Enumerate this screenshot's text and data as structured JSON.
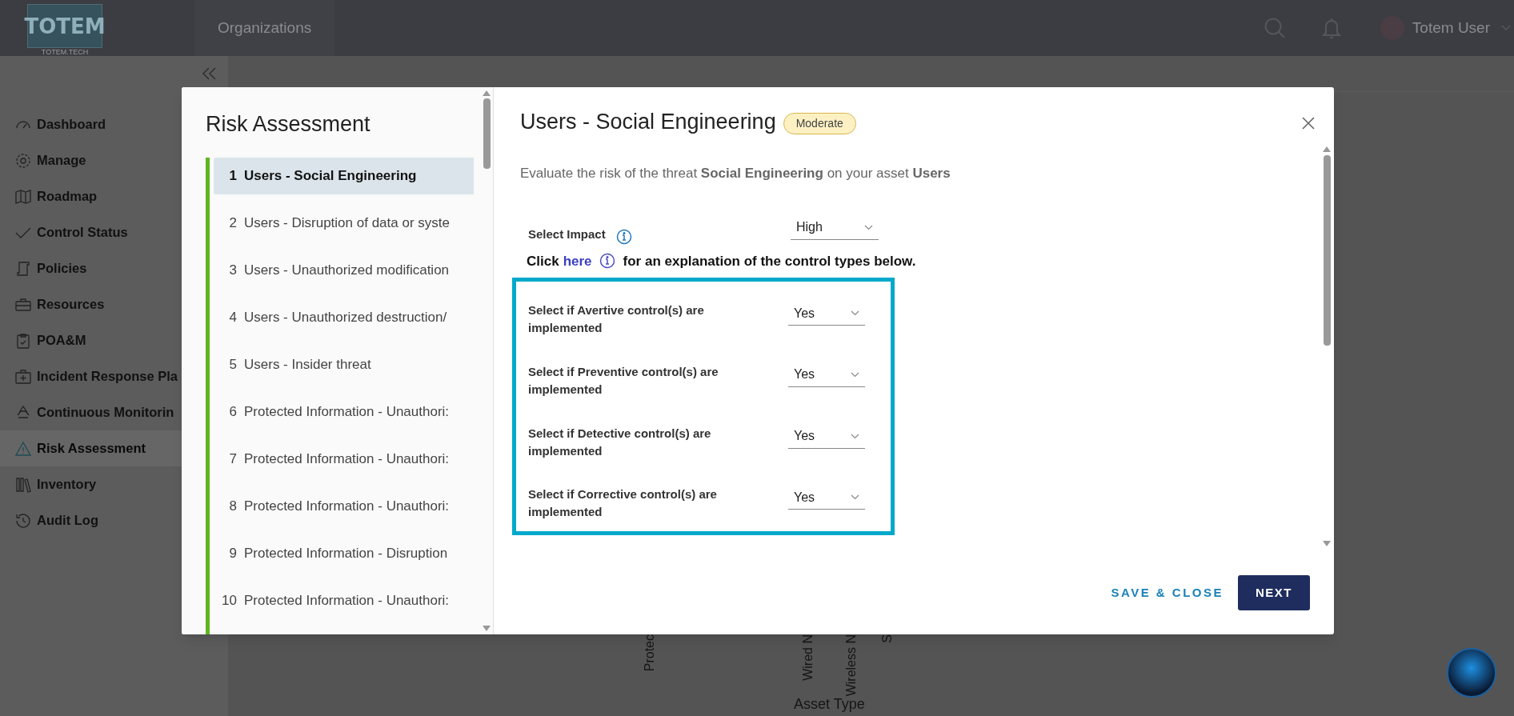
{
  "top_bar": {
    "logo": "TOTEM",
    "logo_caption": "TOTEM.TECH",
    "nav_tab": "Organizations",
    "user_name": "Totem User"
  },
  "sidebar": {
    "items": [
      {
        "label": "Dashboard",
        "selected": false
      },
      {
        "label": "Manage",
        "selected": false
      },
      {
        "label": "Roadmap",
        "selected": false
      },
      {
        "label": "Control Status",
        "selected": false
      },
      {
        "label": "Policies",
        "selected": false
      },
      {
        "label": "Resources",
        "selected": false
      },
      {
        "label": "POA&M",
        "selected": false
      },
      {
        "label": "Incident Response Pla",
        "selected": false
      },
      {
        "label": "Continuous Monitorin",
        "selected": false
      },
      {
        "label": "Risk Assessment",
        "selected": true
      },
      {
        "label": "Inventory",
        "selected": false
      },
      {
        "label": "Audit Log",
        "selected": false
      }
    ]
  },
  "background_chart": {
    "axis_labels": [
      "Protec",
      "Wired N",
      "Wireless N",
      "S"
    ],
    "axis_title": "Asset Type"
  },
  "modal": {
    "list_title": "Risk Assessment",
    "threats": [
      {
        "number": "1",
        "label": "Users - Social Engineering",
        "selected": true
      },
      {
        "number": "2",
        "label": "Users - Disruption of data or syste",
        "selected": false
      },
      {
        "number": "3",
        "label": "Users - Unauthorized modification",
        "selected": false
      },
      {
        "number": "4",
        "label": "Users - Unauthorized destruction/",
        "selected": false
      },
      {
        "number": "5",
        "label": "Users - Insider threat",
        "selected": false
      },
      {
        "number": "6",
        "label": "Protected Information - Unauthori:",
        "selected": false
      },
      {
        "number": "7",
        "label": "Protected Information - Unauthori:",
        "selected": false
      },
      {
        "number": "8",
        "label": "Protected Information - Unauthori:",
        "selected": false
      },
      {
        "number": "9",
        "label": "Protected Information - Disruption",
        "selected": false
      },
      {
        "number": "10",
        "label": "Protected Information - Unauthori:",
        "selected": false
      }
    ],
    "title": "Users - Social Engineering",
    "risk_badge": "Moderate",
    "description": "Evaluate the risk of the threat **Social Engineering** on your asset **Users**",
    "impact": {
      "label": "Select Impact",
      "value": "High"
    },
    "explanation": {
      "prefix": "Click",
      "link": "here",
      "suffix": "for an explanation of the control types below."
    },
    "controls": [
      {
        "label": "Select if Avertive control(s) are implemented",
        "value": "Yes"
      },
      {
        "label": "Select if Preventive control(s) are implemented",
        "value": "Yes"
      },
      {
        "label": "Select if Detective control(s) are implemented",
        "value": "Yes"
      },
      {
        "label": "Select if Corrective control(s) are implemented",
        "value": "Yes"
      }
    ],
    "buttons": {
      "secondary": "SAVE & CLOSE",
      "primary": "NEXT"
    }
  }
}
